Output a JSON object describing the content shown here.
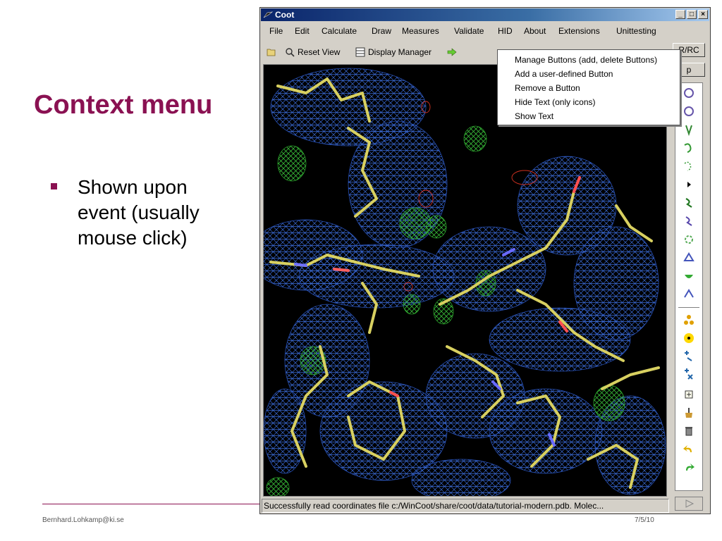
{
  "slide": {
    "title": "Context menu",
    "bullet": "Shown upon event (usually mouse click)",
    "footer_email": "Bernhard.Lohkamp@ki.se",
    "footer_date": "7/5/10",
    "accent_color": "#8a1152"
  },
  "window": {
    "title": "Coot",
    "minimize_label": "_",
    "maximize_label": "□",
    "close_label": "×",
    "menu": [
      {
        "label": "File"
      },
      {
        "label": "Edit"
      },
      {
        "label": "Calculate"
      },
      {
        "label": "Draw"
      },
      {
        "label": "Measures"
      },
      {
        "label": "Validate"
      },
      {
        "label": "HID"
      },
      {
        "label": "About"
      },
      {
        "label": "Extensions"
      },
      {
        "label": "Unittesting"
      }
    ],
    "toolbar": {
      "open_icon": "folder-open-icon",
      "reset_view": "Reset View",
      "display_manager": "Display Manager",
      "go_icon": "arrow-go-icon"
    },
    "status": "Successfully read coordinates file c:/WinCoot/share/coot/data/tutorial-modern.pdb.  Molec...",
    "right_panel": {
      "rrc": "R/RC",
      "map": "p"
    }
  },
  "context_menu": {
    "items": [
      {
        "label": "Manage Buttons (add, delete Buttons)"
      },
      {
        "label": "Add a user-defined Button"
      },
      {
        "label": "Remove a Button"
      },
      {
        "label": "Hide Text (only icons)"
      },
      {
        "label": "Show Text"
      }
    ]
  }
}
